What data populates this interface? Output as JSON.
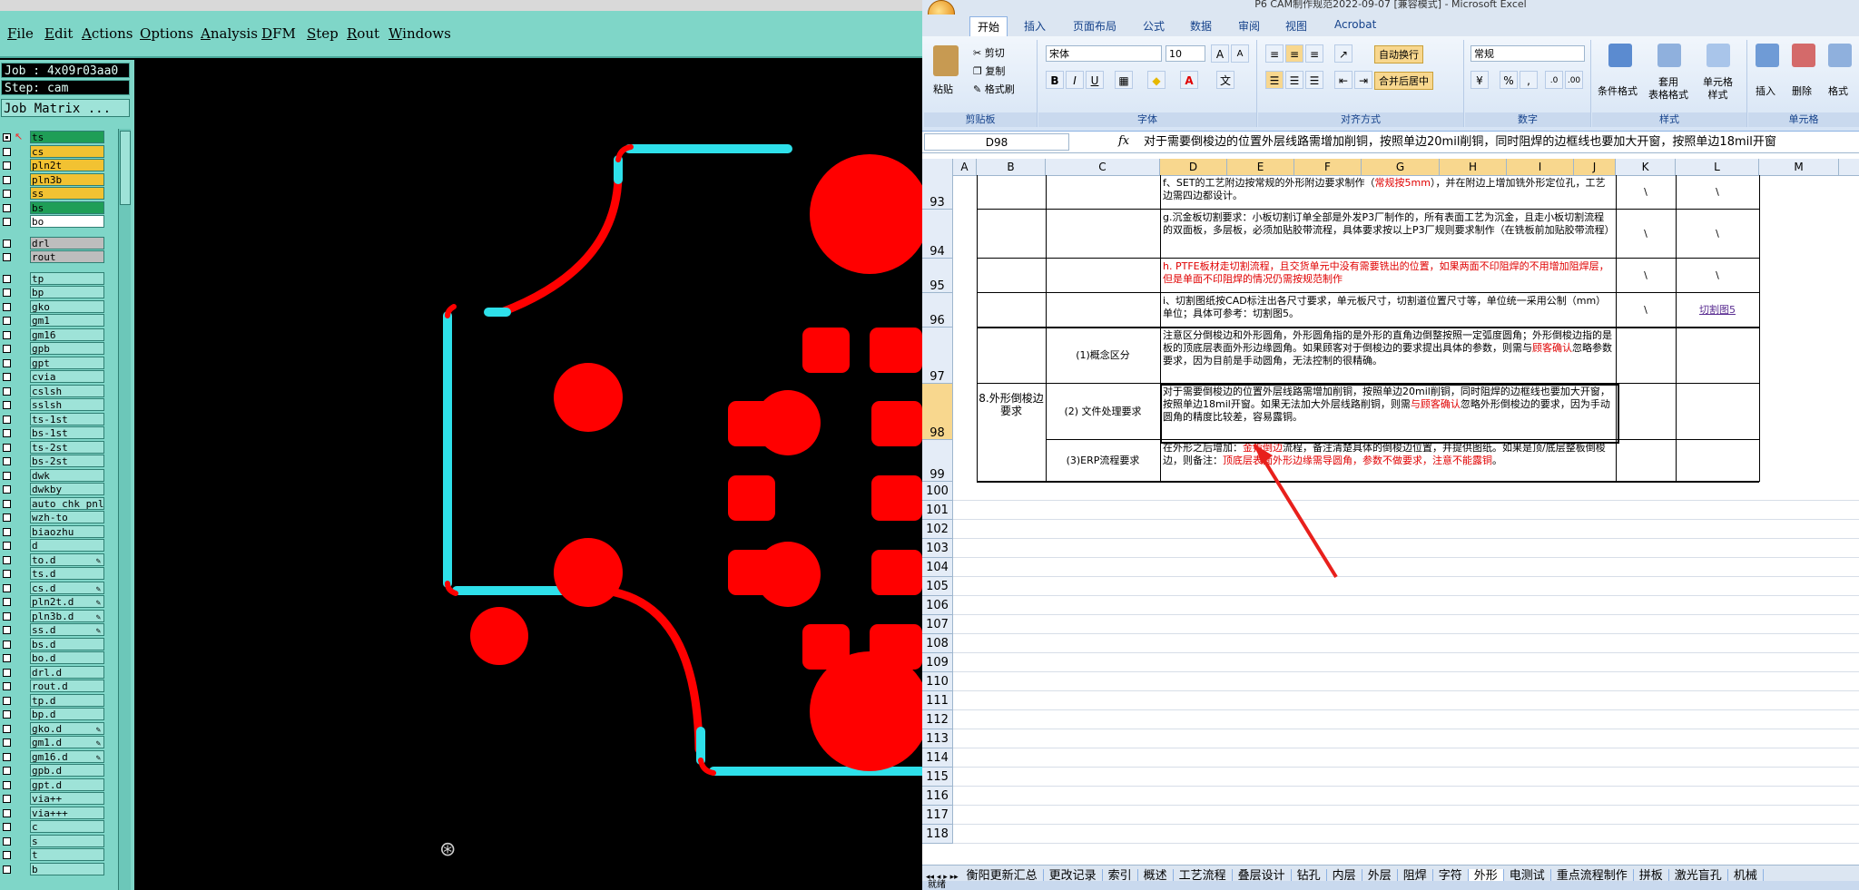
{
  "cam": {
    "menu": [
      "File",
      "Edit",
      "Actions",
      "Options",
      "Analysis",
      "DFM",
      "Step",
      "Rout",
      "Windows"
    ],
    "job_line": "Job : 4x09r03aa0",
    "step_line": "Step: cam",
    "job_matrix_button": "Job Matrix ...",
    "layers_top": [
      {
        "name": "ts",
        "color": "#1f9e57",
        "checked": true,
        "arrow": true
      },
      {
        "name": "cs",
        "color": "#f2c232"
      },
      {
        "name": "pln2t",
        "color": "#f2c232"
      },
      {
        "name": "pln3b",
        "color": "#f2c232"
      },
      {
        "name": "ss",
        "color": "#f2c232"
      },
      {
        "name": "bs",
        "color": "#1f9e57"
      },
      {
        "name": "bo",
        "color": "#ffffff"
      }
    ],
    "layers_drill": [
      {
        "name": "drl",
        "color": "#bdbdbd"
      },
      {
        "name": "rout",
        "color": "#bdbdbd"
      }
    ],
    "layers_misc": [
      {
        "name": "tp"
      },
      {
        "name": "bp"
      },
      {
        "name": "gko"
      },
      {
        "name": "gm1"
      },
      {
        "name": "gm16"
      },
      {
        "name": "gpb"
      },
      {
        "name": "gpt"
      },
      {
        "name": "cvia"
      },
      {
        "name": "cslsh"
      },
      {
        "name": "sslsh"
      },
      {
        "name": "ts-1st"
      },
      {
        "name": "bs-1st"
      },
      {
        "name": "ts-2st"
      },
      {
        "name": "bs-2st"
      },
      {
        "name": "dwk"
      },
      {
        "name": "dwkby"
      },
      {
        "name": "auto_chk_pnl"
      },
      {
        "name": "wzh-to"
      },
      {
        "name": "biaozhu"
      },
      {
        "name": "d"
      },
      {
        "name": "to.d",
        "pen": true
      },
      {
        "name": "ts.d"
      },
      {
        "name": "cs.d",
        "pen": true
      },
      {
        "name": "pln2t.d",
        "pen": true
      },
      {
        "name": "pln3b.d",
        "pen": true
      },
      {
        "name": "ss.d",
        "pen": true
      },
      {
        "name": "bs.d"
      },
      {
        "name": "bo.d"
      },
      {
        "name": "drl.d"
      },
      {
        "name": "rout.d"
      },
      {
        "name": "tp.d"
      },
      {
        "name": "bp.d"
      },
      {
        "name": "gko.d",
        "pen": true
      },
      {
        "name": "gm1.d",
        "pen": true
      },
      {
        "name": "gm16.d",
        "pen": true
      },
      {
        "name": "gpb.d"
      },
      {
        "name": "gpt.d"
      },
      {
        "name": "via++"
      },
      {
        "name": "via+++"
      },
      {
        "name": "c"
      },
      {
        "name": "s"
      },
      {
        "name": "t"
      },
      {
        "name": "b"
      }
    ],
    "colors": {
      "outline": "#2ee0ea",
      "pad": "#ff0000",
      "background": "#000000",
      "panel": "#7fd6c8"
    }
  },
  "excel": {
    "window_title": "P6 CAM制作规范2022-09-07 [兼容模式] - Microsoft Excel",
    "ribbon_tabs": [
      "开始",
      "插入",
      "页面布局",
      "公式",
      "数据",
      "审阅",
      "视图",
      "Acrobat"
    ],
    "active_tab": "开始",
    "clipboard": {
      "paste": "粘贴",
      "cut": "剪切",
      "copy": "复制",
      "format_painter": "格式刷",
      "label": "剪贴板"
    },
    "font": {
      "name": "宋体",
      "size": "10",
      "bold": "B",
      "italic": "I",
      "underline": "U",
      "label": "字体"
    },
    "alignment": {
      "wrap": "自动换行",
      "merge": "合并后居中",
      "label": "对齐方式"
    },
    "number": {
      "format": "常规",
      "percent": "%",
      "comma": ",",
      "label": "数字"
    },
    "styles": {
      "conditional": "条件格式",
      "table": "套用\n表格格式",
      "cell": "单元格\n样式",
      "label": "样式"
    },
    "cells": {
      "insert": "插入",
      "delete": "删除",
      "format": "格式",
      "label": "单元格"
    },
    "name_box": "D98",
    "fx": "fx",
    "formula": "对于需要倒梭边的位置外层线路需增加削铜，按照单边20mil削铜，同时阻焊的边框线也要加大开窗，按照单边18mil开窗",
    "columns": [
      "A",
      "B",
      "C",
      "D",
      "E",
      "F",
      "G",
      "H",
      "I",
      "J",
      "K",
      "L",
      "M"
    ],
    "selected_columns": [
      "D",
      "E",
      "F",
      "G",
      "H",
      "I",
      "J"
    ],
    "rows": {
      "r93": {
        "num": "93",
        "d": "f、SET的工艺附边按常规的外形附边要求制作（",
        "d_red": "常规按5mm",
        "d_end": "），并在附边上增加铣外形定位孔，工艺边需四边都设计。",
        "k": "\\",
        "l": "\\"
      },
      "r94": {
        "num": "94",
        "d": "g.沉金板切割要求：小板切割订单全部是外发P3厂制作的，所有表面工艺为沉金，且走小板切割流程的双面板，多层板，必须加贴胶带流程，具体要求按以上P3厂规则要求制作（在铣板前加贴胶带流程）",
        "k": "\\",
        "l": "\\"
      },
      "r95": {
        "num": "95",
        "d_red": "h. PTFE板材走切割流程，且交货单元中没有需要铣出的位置，如果两面不印阻焊的不用增加阻焊层，但是单面不印阻焊的情况仍需按规范制作",
        "k": "\\",
        "l": "\\"
      },
      "r96": {
        "num": "96",
        "d": "i、切割图纸按CAD标注出各尺寸要求，单元板尺寸，切割道位置尺寸等，单位统一采用公制（mm）单位；具体可参考：切割图5。",
        "k": "\\",
        "l_link": "切割图5"
      },
      "r97": {
        "num": "97",
        "c": "(1)概念区分",
        "d": "注意区分倒梭边和外形圆角，外形圆角指的是外形的直角边倒整按照一定弧度圆角；外形倒梭边指的是板的顶底层表面外形边缘圆角。如果顾客对于倒梭边的要求提出具体的参数，则需与",
        "d_red": "顾客确认",
        "d_end": "忽略参数要求，因为目前是手动圆角，无法控制的很精确。"
      },
      "r98": {
        "num": "98",
        "b": "8.外形倒梭边要求",
        "c": "(2) 文件处理要求",
        "d": "对于需要倒梭边的位置外层线路需增加削铜，按照单边20mil削铜，同时阻焊的边框线也要加大开窗，按照单边18mil开窗。如果无法加大外层线路削铜，则需",
        "d_red": "与顾客确认",
        "d_end": "忽略外形倒梭边的要求，因为手动圆角的精度比较差，容易露铜。"
      },
      "r99": {
        "num": "99",
        "c": "(3)ERP流程要求",
        "d": "在外形之后增加：",
        "d_red": "金指倒边",
        "d_mid": "流程，备注清楚具体的倒梭边位置，并提供图纸。如果是顶/底层整板倒梭边，则备注：",
        "d_red2": "顶底层表面外形边缘需导圆角，参数不做要求，注意不能露铜",
        "d_end": "。"
      }
    },
    "empty_rows": [
      "100",
      "101",
      "102",
      "103",
      "104",
      "105",
      "106",
      "107",
      "108",
      "109",
      "110",
      "111",
      "112",
      "113",
      "114",
      "115",
      "116",
      "117",
      "118"
    ],
    "sheet_tabs": [
      "衡阳更新汇总",
      "更改记录",
      "索引",
      "概述",
      "工艺流程",
      "叠层设计",
      "钻孔",
      "内层",
      "外层",
      "阻焊",
      "字符",
      "外形",
      "电测试",
      "重点流程制作",
      "拼板",
      "激光盲孔",
      "机械"
    ],
    "status": "就绪",
    "colors": {
      "header_bg": "#e4ecf7",
      "selected_header": "#f8d78e",
      "red_text": "#e00000",
      "arrow": "#e8201c"
    }
  }
}
